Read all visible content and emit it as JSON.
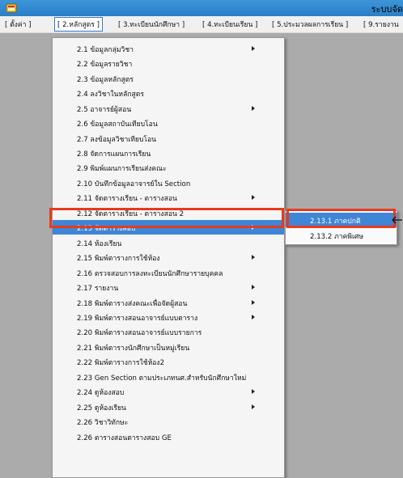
{
  "window": {
    "title": "ระบบจัด"
  },
  "menubar": [
    "[ ตั้งค่า ]",
    "[ 2.หลักสูตร ]",
    "[ 3.ทะเบียนนักศึกษา ]",
    "[ 4.ทะเบียนเรียน ]",
    "[ 5.ประมวลผลการเรียน ]",
    "[ 9.รายงาน"
  ],
  "dropdown": {
    "items": [
      "2.1 ข้อมูลกลุ่มวิชา",
      "2.2 ข้อมูลรายวิชา",
      "2.3 ข้อมูลหลักสูตร",
      "2.4 ลงวิชาในหลักสูตร",
      "2.5 อาจารย์ผู้สอน",
      "2.6 ข้อมูลสถาบันเทียบโอน",
      "2.7 ลงข้อมูลวิชาเทียบโอน",
      "2.8 จัดการแผนการเรียน",
      "2.9 พิมพ์แผนการเรียนส่งคณะ",
      "2.10 บันทึกข้อมูลอาจารย์ใน Section",
      "2.11 จัดตารางเรียน - ตารางสอน",
      "2.12 จัดตารางเรียน - ตารางสอน 2",
      "2.13 จัดตารางสอบ",
      "2.14 ห้องเรียน",
      "2.15 พิมพ์ตารางการใช้ห้อง",
      "2.16 ตรวจสอบการลงทะเบียนนักศึกษารายบุคคล",
      "2.17 รายงาน",
      "2.18 พิมพ์ตารางส่งคณะเพื่อจัดผู้สอน",
      "2.19 พิมพ์ตารางสอนอาจารย์แบบตาราง",
      "2.20 พิมพ์ตารางสอนอาจารย์แบบรายการ",
      "2.21 พิมพ์ตารางนักศึกษาเป็นหมู่เรียน",
      "2.22 พิมพ์ตารางการใช้ห้อง2",
      "2.23 Gen Section ตามประเภทนศ.สำหรับนักศึกษาใหม่",
      "2.24 ดูห้องสอบ",
      "2.25 ดูห้องเรียน",
      "2.26 วิชาวิทักษะ",
      "2.26 ตารางสอนตารางสอบ GE"
    ]
  },
  "submenu": {
    "items": [
      "2.13.1 ภาคปกติ",
      "2.13.2 ภาคพิเศษ"
    ]
  },
  "colors": {
    "titlebar": "#2f86cf",
    "selection": "#3f86d6",
    "highlight_box": "#e8391d",
    "client_bg": "#ababab"
  }
}
